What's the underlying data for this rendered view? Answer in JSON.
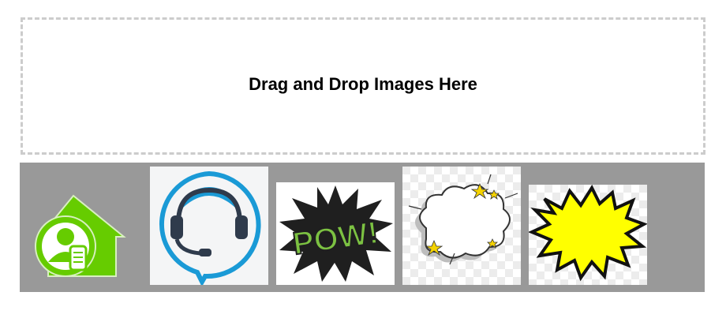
{
  "dropzone": {
    "label": "Drag and Drop Images Here"
  },
  "gallery": {
    "items": [
      {
        "icon": "home-user-icon",
        "accent": "#66cc00"
      },
      {
        "icon": "headset-support-icon",
        "accent": "#1a9ad6"
      },
      {
        "icon": "pow-comic-icon",
        "accent": "#7cc242",
        "text": "POW!"
      },
      {
        "icon": "cloud-burst-comic-icon",
        "accent": "#f5d300"
      },
      {
        "icon": "yellow-starburst-icon",
        "accent": "#ffff00"
      }
    ]
  },
  "colors": {
    "dropzone_border": "#cccccc",
    "gallery_background": "#999999"
  }
}
